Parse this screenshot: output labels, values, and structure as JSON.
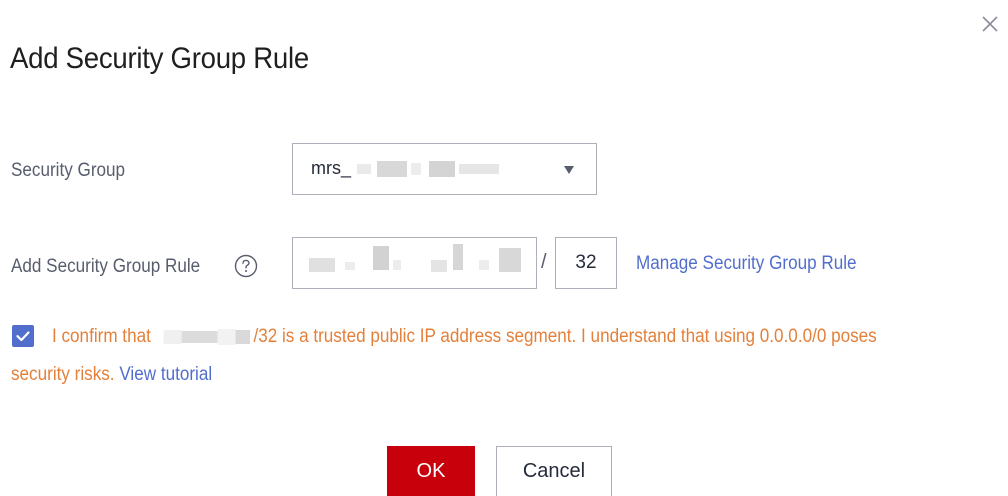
{
  "dialog": {
    "title": "Add Security Group Rule",
    "close_icon": "close-icon"
  },
  "security_group": {
    "label": "Security Group",
    "selected_value": "mrs_"
  },
  "rule": {
    "label": "Add Security Group Rule",
    "help_icon": "help-icon",
    "separator": "/",
    "mask_value": "32",
    "manage_link": "Manage Security Group Rule"
  },
  "confirm": {
    "checked": true,
    "text_before": "I confirm that",
    "text_after": "/32 is a trusted public IP address segment. I understand that using 0.0.0.0/0 poses",
    "line2_text": "security risks.",
    "tutorial_link": "View tutorial"
  },
  "buttons": {
    "ok_label": "OK",
    "cancel_label": "Cancel"
  },
  "colors": {
    "primary_red": "#c7000b",
    "link_blue": "#526ecc",
    "warning_orange": "#e4803a"
  }
}
